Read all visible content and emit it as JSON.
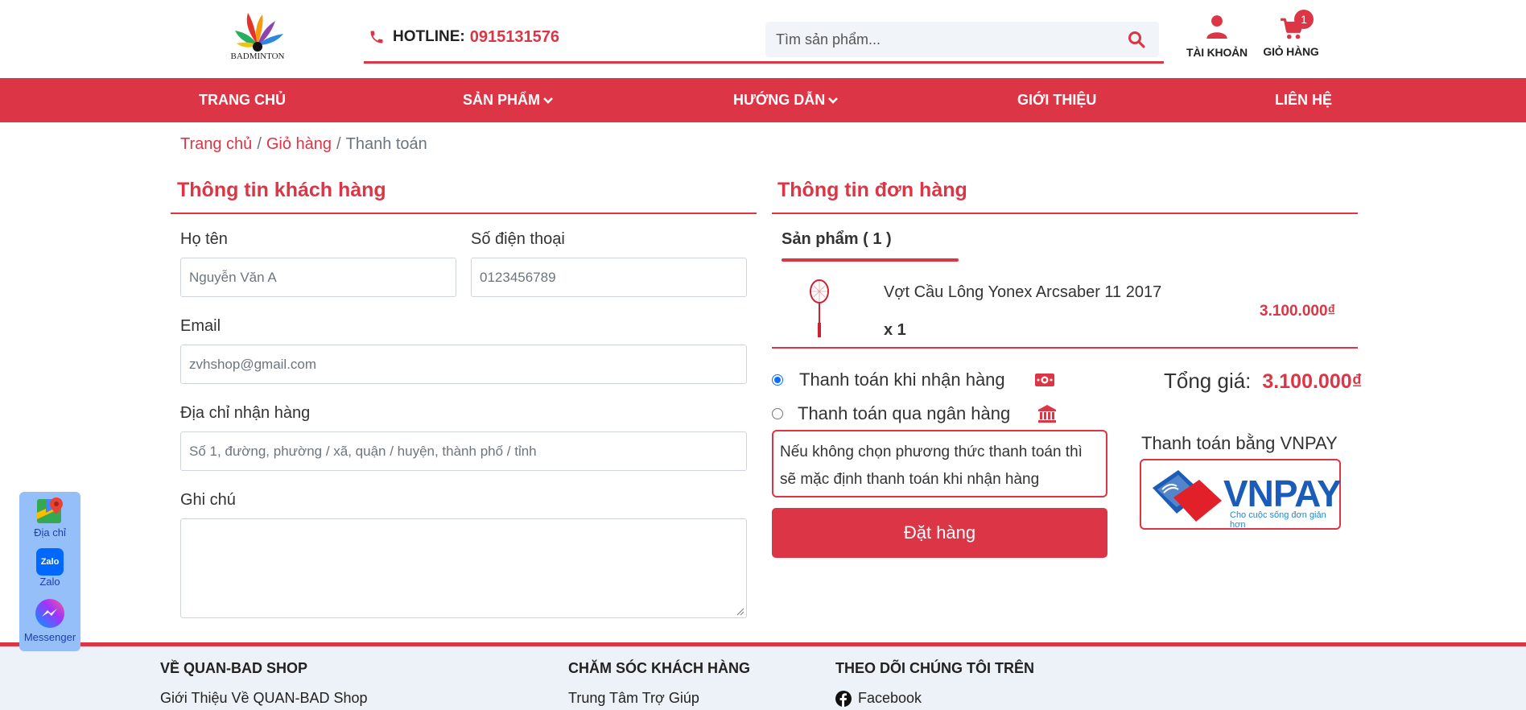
{
  "header": {
    "logo_text": "BADMINTON",
    "hotline_label": "HOTLINE:",
    "hotline_number": "0915131576",
    "search_placeholder": "Tìm sản phẩm...",
    "account_label": "TÀI KHOẢN",
    "cart_label": "GIỎ HÀNG",
    "cart_count": "1"
  },
  "nav": {
    "items": [
      {
        "label": "TRANG CHỦ",
        "has_dropdown": false
      },
      {
        "label": "SẢN PHẨM",
        "has_dropdown": true
      },
      {
        "label": "HƯỚNG DẪN",
        "has_dropdown": true
      },
      {
        "label": "GIỚI THIỆU",
        "has_dropdown": false
      },
      {
        "label": "LIÊN HỆ",
        "has_dropdown": false
      }
    ]
  },
  "breadcrumb": {
    "home": "Trang chủ",
    "cart": "Giỏ hàng",
    "current": "Thanh toán",
    "separator": "/"
  },
  "customer": {
    "title": "Thông tin khách hàng",
    "name_label": "Họ tên",
    "name_placeholder": "Nguyễn Văn A",
    "phone_label": "Số điện thoại",
    "phone_placeholder": "0123456789",
    "email_label": "Email",
    "email_placeholder": "zvhshop@gmail.com",
    "address_label": "Địa chỉ nhận hàng",
    "address_placeholder": "Số 1, đường, phường / xã, quận / huyện, thành phố / tỉnh",
    "note_label": "Ghi chú",
    "note_value": ""
  },
  "order": {
    "title": "Thông tin đơn hàng",
    "products_tab": "Sản phẩm ( 1 )",
    "product": {
      "name": "Vợt Cầu Lông Yonex Arcsaber 11 2017",
      "quantity": "x 1",
      "price": "3.100.000₫"
    },
    "payment_cod": "Thanh toán khi nhận hàng",
    "payment_bank": "Thanh toán qua ngân hàng",
    "selected_payment": "cod",
    "note": "Nếu không chọn phương thức thanh toán thì sẽ mặc định thanh toán khi nhận hàng",
    "place_order": "Đặt hàng",
    "total_label": "Tổng giá:",
    "total_value": "3.100.000₫",
    "vnpay_title": "Thanh toán bằng VNPAY",
    "vnpay_logo_text": "VNPAY",
    "vnpay_slogan": "Cho cuộc sống đơn giản hơn"
  },
  "contact_widget": {
    "map_label": "Địa chỉ",
    "zalo_label": "Zalo",
    "zalo_icon_text": "Zalo",
    "messenger_label": "Messenger"
  },
  "footer": {
    "col1_title": "VỀ QUAN-BAD SHOP",
    "col1_link": "Giới Thiệu Về QUAN-BAD Shop",
    "col2_title": "CHĂM SÓC KHÁCH HÀNG",
    "col2_link": "Trung Tâm Trợ Giúp",
    "col3_title": "THEO DÕI CHÚNG TÔI TRÊN",
    "col3_link": "Facebook"
  },
  "colors": {
    "primary": "#dc3545",
    "nav_text": "#ffffff",
    "footer_bg": "#edf2f8",
    "contact_bg": "#94bff8",
    "radio_selected": "#0d6efd"
  },
  "icons": {
    "phone": "phone-icon",
    "search": "search-icon",
    "account": "user-icon",
    "cart": "cart-icon",
    "dropdown": "chevron-down-icon",
    "cod": "money-icon",
    "bank": "bank-icon",
    "map": "map-icon",
    "zalo": "zalo-icon",
    "messenger": "messenger-icon",
    "facebook": "facebook-icon"
  }
}
